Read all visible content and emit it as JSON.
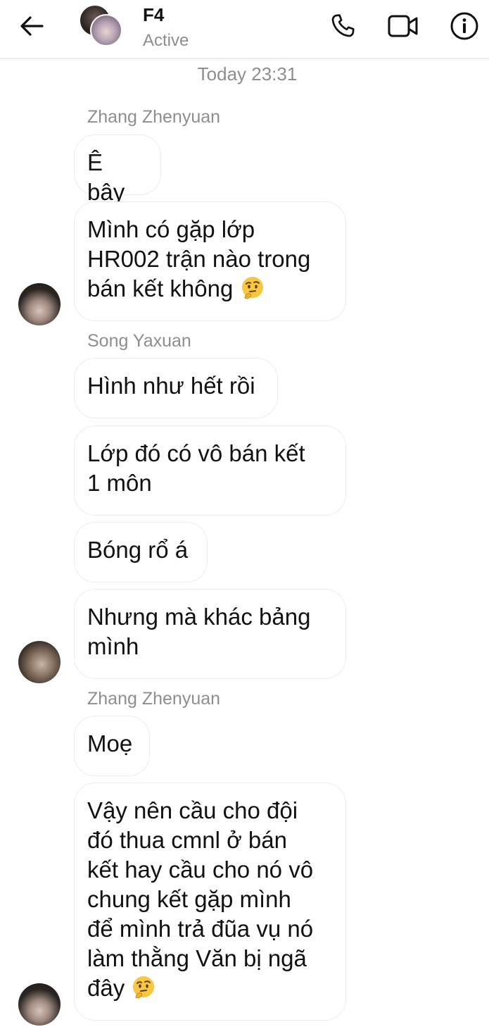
{
  "header": {
    "title": "F4",
    "status": "Active",
    "icons": [
      "back-arrow-icon",
      "phone-icon",
      "video-icon",
      "info-icon"
    ]
  },
  "timestamp": "Today 23:31",
  "messages": [
    {
      "sender": "Zhang Zhenyuan",
      "text": "Ê bây"
    },
    {
      "text": "Mình có gặp lớp",
      "line2": "HR002 trận nào trong",
      "line3": "bán kết không",
      "emoji": "thinking-face"
    },
    {
      "sender": "Song Yaxuan",
      "text": "Hình như hết rồi"
    },
    {
      "text": "Lớp đó có vô bán kết",
      "line2": "1 môn"
    },
    {
      "text": "Bóng rổ á"
    },
    {
      "text": "Nhưng mà khác bảng",
      "line2": "mình"
    },
    {
      "sender": "Zhang Zhenyuan",
      "text": "Moẹ"
    },
    {
      "text": "Vậy nên cầu cho đội",
      "line2": "đó thua cmnl ở bán",
      "line3": "kết hay cầu cho nó vô",
      "line4": "chung kết gặp mình",
      "line5": "để mình trả đũa vụ nó",
      "line6": "làm thằng Văn bị ngã",
      "line7": "đây",
      "emoji": "thinking-face"
    }
  ],
  "colors": {
    "bubble_border": "#ececec",
    "meta_text": "#8e8e8e",
    "emoji": "#f7c744"
  }
}
